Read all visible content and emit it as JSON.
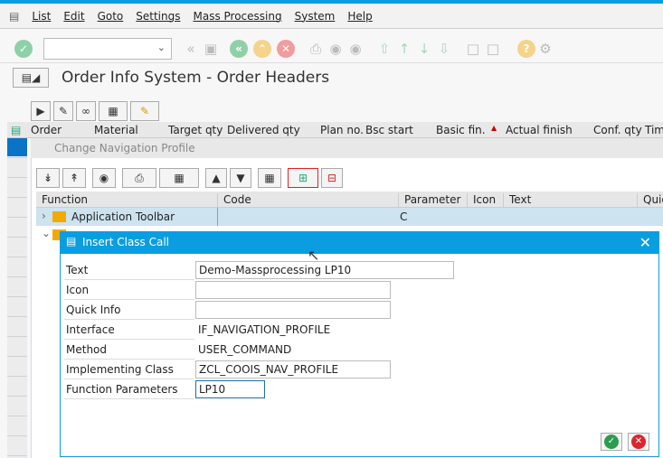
{
  "menu": {
    "items": [
      "List",
      "Edit",
      "Goto",
      "Settings",
      "Mass Processing",
      "System",
      "Help"
    ]
  },
  "toolbar": {
    "command_value": ""
  },
  "page": {
    "title": "Order Info System - Order Headers"
  },
  "grid": {
    "columns": [
      "Order",
      "Material",
      "Target qty",
      "Delivered qty",
      "Plan no.",
      "Bsc start",
      "Basic fin.",
      "Actual finish",
      "Conf. qty",
      "Tim"
    ]
  },
  "panel": {
    "title": "Change Navigation Profile",
    "tree_columns": [
      "Function",
      "Code",
      "Parameter",
      "Icon",
      "Text",
      "Quic"
    ],
    "rows": [
      {
        "function": "Application Toolbar",
        "code": "",
        "parameter": "C"
      }
    ],
    "folder_color": "#f0ab00"
  },
  "dialog": {
    "title": "Insert Class Call",
    "fields": {
      "text_label": "Text",
      "text_value": "Demo-Massprocessing LP10",
      "icon_label": "Icon",
      "icon_value": "",
      "quickinfo_label": "Quick Info",
      "quickinfo_value": "",
      "interface_label": "Interface",
      "interface_value": "IF_NAVIGATION_PROFILE",
      "method_label": "Method",
      "method_value": "USER_COMMAND",
      "class_label": "Implementing Class",
      "class_value": "ZCL_COOIS_NAV_PROFILE",
      "params_label": "Function Parameters",
      "params_value": "LP10"
    },
    "accent": "#0a9ee0"
  }
}
